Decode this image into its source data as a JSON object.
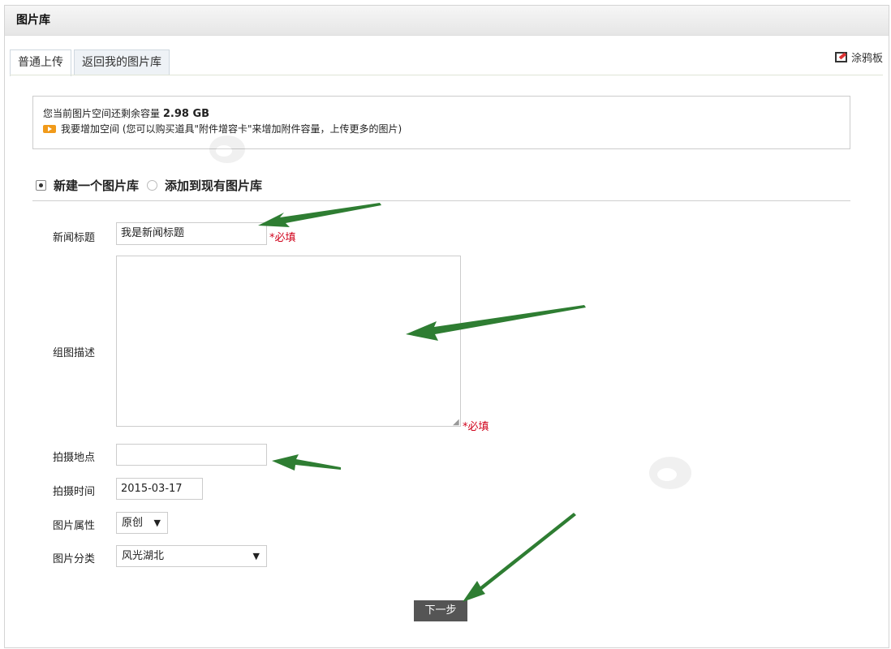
{
  "header": {
    "title": "图片库"
  },
  "tabs": [
    {
      "label": "普通上传",
      "active": true
    },
    {
      "label": "返回我的图片库",
      "active": false
    }
  ],
  "graffiti": {
    "label": "涂鸦板",
    "icon": "graffiti-board-icon"
  },
  "info": {
    "line1_prefix": "您当前图片空间还剩余容量",
    "capacity": "2.98 GB",
    "line2": "我要增加空间 (您可以购买道具\"附件增容卡\"来增加附件容量，上传更多的图片)"
  },
  "mode": {
    "option_new": "新建一个图片库",
    "option_existing": "添加到现有图片库",
    "selected": "新建一个图片库"
  },
  "form": {
    "title_label": "新闻标题",
    "title_value": "我是新闻标题",
    "required_mark": "*必填",
    "desc_label": "组图描述",
    "desc_value": "",
    "location_label": "拍摄地点",
    "location_value": "",
    "date_label": "拍摄时间",
    "date_value": "2015-03-17",
    "attr_label": "图片属性",
    "attr_value": "原创",
    "category_label": "图片分类",
    "category_value": "风光湖北"
  },
  "buttons": {
    "next": "下一步"
  },
  "colors": {
    "required": "#d0021b",
    "arrow": "#2e7d32",
    "button_bg": "#555555"
  }
}
